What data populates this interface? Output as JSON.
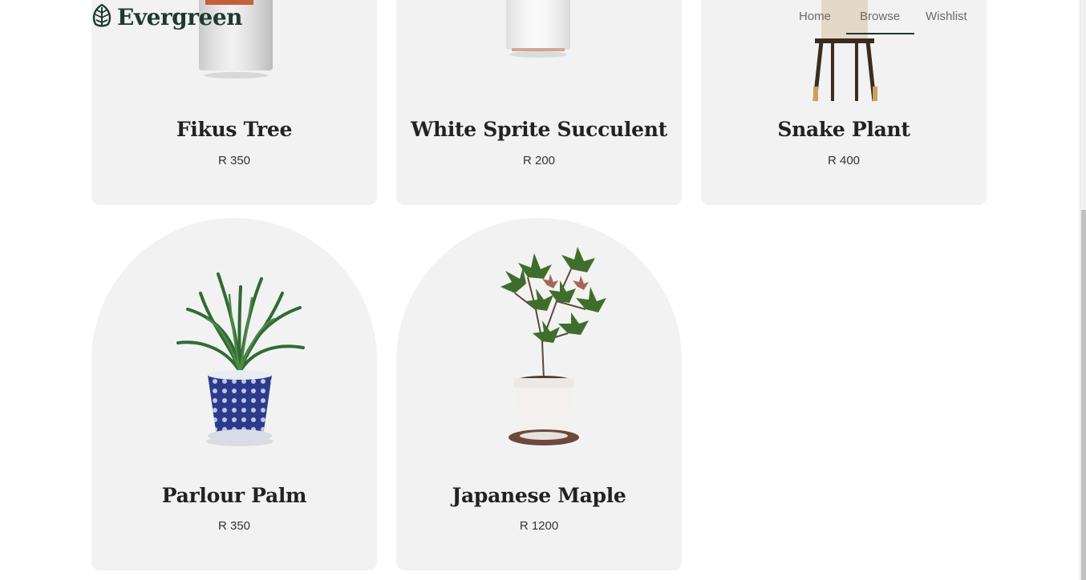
{
  "brand": {
    "name": "Evergreen",
    "logo_icon": "leaf-icon"
  },
  "nav": {
    "items": [
      {
        "label": "Home"
      },
      {
        "label": "Browse",
        "active": true
      },
      {
        "label": "Wishlist"
      }
    ]
  },
  "products": [
    {
      "name": "Fikus Tree",
      "price": "R 350",
      "image": "white-pot-plant"
    },
    {
      "name": "White Sprite Succulent",
      "price": "R 200",
      "image": "white-pot"
    },
    {
      "name": "Snake Plant",
      "price": "R 400",
      "image": "pot-on-stand"
    },
    {
      "name": "Parlour Palm",
      "price": "R 350",
      "image": "palm-in-blue-pot"
    },
    {
      "name": "Japanese Maple",
      "price": "R 1200",
      "image": "maple-in-white-pot"
    }
  ],
  "colors": {
    "brand": "#1e3a30",
    "card_bg": "#f2f2f2",
    "nav_text": "#6b6b6b"
  }
}
